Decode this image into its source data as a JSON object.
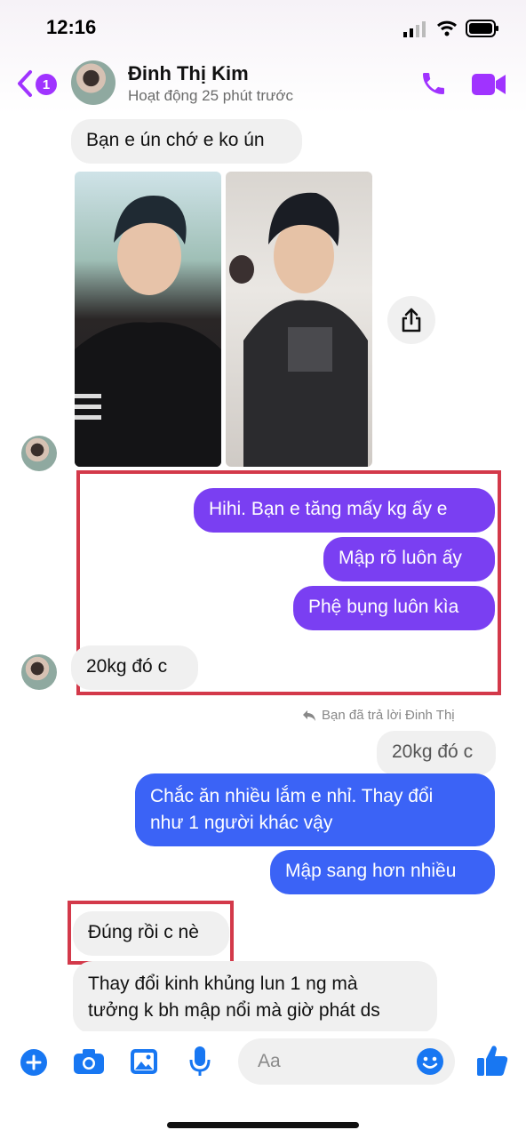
{
  "status_bar": {
    "time": "12:16"
  },
  "header": {
    "unread_count": "1",
    "contact_name": "Đinh Thị Kim",
    "contact_status": "Hoạt động 25 phút trước",
    "accent_color": "#a033ff"
  },
  "messages": {
    "m1": "Bạn e ún chớ e ko ún",
    "m2": "Hihi. Bạn e tăng mấy kg ấy e",
    "m3": "Mập rõ luôn ấy",
    "m4": "Phệ bụng luôn kìa",
    "m5": "20kg đó c",
    "reply_label": "Bạn đã trả lời Đinh Thị",
    "quoted": "20kg đó c",
    "m6_line1": "Chắc ăn nhiều lắm e nhỉ. Thay đổi",
    "m6_line2": "như 1 người khác vậy",
    "m7": "Mập sang hơn nhiều",
    "m8": "Đúng rồi c nè",
    "m9_line1": "Thay đổi kinh khủng lun 1 ng mà",
    "m9_line2": "tưởng k bh mập nổi mà giờ phát ds"
  },
  "composer": {
    "placeholder": "Aa"
  },
  "colors": {
    "purple_bubble": "#7a3ff2",
    "blue_bubble": "#3b63f6",
    "icon_blue": "#1877f2",
    "highlight": "#d3394a"
  }
}
